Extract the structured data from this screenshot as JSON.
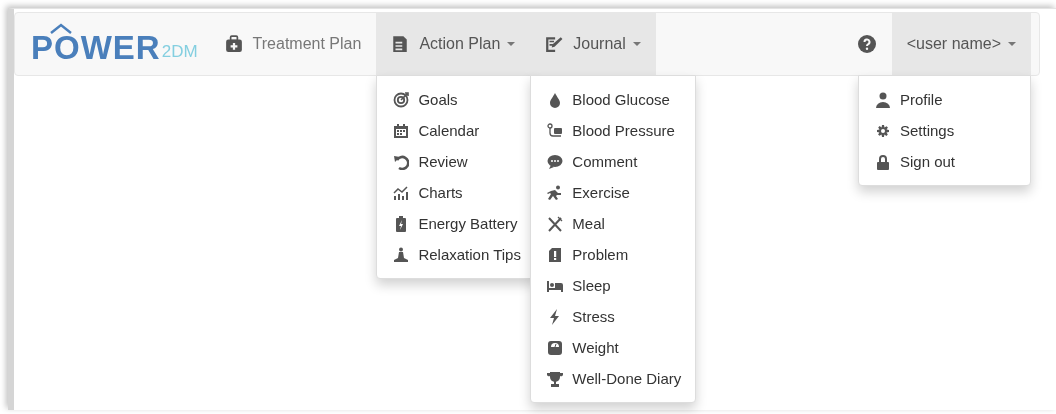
{
  "logo": {
    "main": "POWER",
    "suffix": "2DM"
  },
  "menus": [
    {
      "label": "Treatment Plan",
      "caret": false,
      "expanded": false
    },
    {
      "label": "Action Plan",
      "caret": true,
      "expanded": true,
      "items": [
        "Goals",
        "Calendar",
        "Review",
        "Charts",
        "Energy Battery",
        "Relaxation Tips"
      ]
    },
    {
      "label": "Journal",
      "caret": true,
      "expanded": true,
      "items": [
        "Blood Glucose",
        "Blood Pressure",
        "Comment",
        "Exercise",
        "Meal",
        "Problem",
        "Sleep",
        "Stress",
        "Weight",
        "Well-Done Diary"
      ]
    }
  ],
  "help": {
    "kind": "icon"
  },
  "user_menu": {
    "label": "<user name>",
    "caret": true,
    "expanded": true,
    "items": [
      "Profile",
      "Settings",
      "Sign out"
    ]
  }
}
